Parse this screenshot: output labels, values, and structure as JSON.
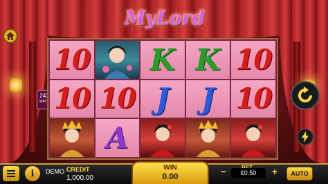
{
  "game": {
    "logo_text": "MyLord",
    "ways_count": "243",
    "ways_label": "WAYS"
  },
  "reels": [
    [
      "10",
      "portrait-lady-lotus",
      "K",
      "K",
      "10"
    ],
    [
      "10",
      "10",
      "J",
      "J",
      "10"
    ],
    [
      "portrait-empress",
      "A",
      "portrait-lady-red",
      "portrait-empress",
      "portrait-lady-red"
    ]
  ],
  "bottom_bar": {
    "menu_icon": "hamburger-menu-icon",
    "info_icon": "info-icon",
    "demo_label": "DEMO",
    "credit_label": "CREDIT",
    "credit_value": "1,000.00",
    "win_label": "WIN",
    "win_value": "0.00",
    "bet_label": "BET",
    "bet_value": "€0.50",
    "bet_minus": "−",
    "bet_plus": "+",
    "auto_label": "AUTO"
  },
  "controls": {
    "home_icon": "home-icon",
    "spin_icon": "refresh-spin-icon",
    "turbo_icon": "lightning-icon"
  },
  "colors": {
    "accent": "#ffd84a",
    "rank_red": "#d41e1e",
    "rank_green": "#2a9a2a",
    "rank_blue": "#2a5ad8",
    "rank_purple": "#8a3ac8"
  }
}
